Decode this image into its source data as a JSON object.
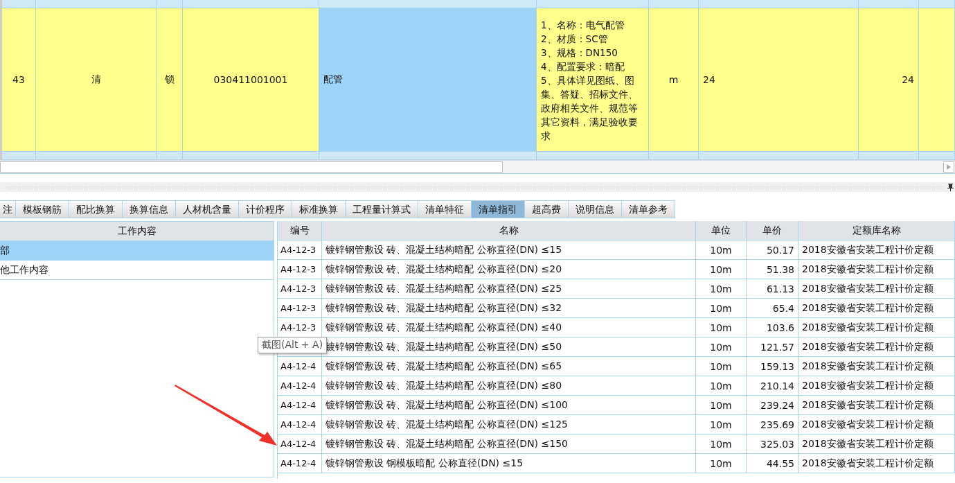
{
  "top_table": {
    "row": {
      "selected": true,
      "cells": [
        {
          "kind": "center",
          "text": "43"
        },
        {
          "kind": "center",
          "text": "清"
        },
        {
          "kind": "center",
          "text": "锁"
        },
        {
          "kind": "center",
          "text": "030411001001"
        },
        {
          "kind": "selected",
          "text": "配管"
        },
        {
          "kind": "multiline",
          "text": "1、名称：电气配管\n2、材质：SC管\n3、规格：DN150\n4、配置要求：暗配\n5、具体详见图纸、图集、答疑、招标文件、政府相关文件、规范等其它资料，满足验收要求"
        },
        {
          "kind": "center",
          "text": "m"
        },
        {
          "kind": "left",
          "text": "24"
        },
        {
          "kind": "right",
          "text": "24"
        },
        {
          "kind": "empty"
        }
      ]
    }
  },
  "tabs": [
    {
      "label": "注",
      "selected": false
    },
    {
      "label": "模板钢筋",
      "selected": false
    },
    {
      "label": "配比换算",
      "selected": false
    },
    {
      "label": "换算信息",
      "selected": false
    },
    {
      "label": "人材机含量",
      "selected": false
    },
    {
      "label": "计价程序",
      "selected": false
    },
    {
      "label": "标准换算",
      "selected": false
    },
    {
      "label": "工程量计算式",
      "selected": false
    },
    {
      "label": "清单特征",
      "selected": false
    },
    {
      "label": "清单指引",
      "selected": true
    },
    {
      "label": "超高费",
      "selected": false
    },
    {
      "label": "说明信息",
      "selected": false
    },
    {
      "label": "清单参考",
      "selected": false
    }
  ],
  "work_panel": {
    "header": "工作内容",
    "items": [
      {
        "text": "部",
        "selected": true
      },
      {
        "text": "他工作内容",
        "selected": false
      }
    ]
  },
  "quota_table": {
    "columns": [
      "编号",
      "名称",
      "单位",
      "单价",
      "定额库名称"
    ],
    "rows": [
      [
        "A4-12-3",
        "镀锌钢管敷设 砖、混凝土结构暗配 公称直径(DN) ≤15",
        "10m",
        "50.17",
        "2018安徽省安装工程计价定额"
      ],
      [
        "A4-12-3",
        "镀锌钢管敷设 砖、混凝土结构暗配 公称直径(DN) ≤20",
        "10m",
        "51.38",
        "2018安徽省安装工程计价定额"
      ],
      [
        "A4-12-3",
        "镀锌钢管敷设 砖、混凝土结构暗配 公称直径(DN) ≤25",
        "10m",
        "61.13",
        "2018安徽省安装工程计价定额"
      ],
      [
        "A4-12-3",
        "镀锌钢管敷设 砖、混凝土结构暗配 公称直径(DN) ≤32",
        "10m",
        "65.4",
        "2018安徽省安装工程计价定额"
      ],
      [
        "A4-12-3",
        "镀锌钢管敷设 砖、混凝土结构暗配 公称直径(DN) ≤40",
        "10m",
        "103.6",
        "2018安徽省安装工程计价定额"
      ],
      [
        null,
        "镀锌钢管敷设 砖、混凝土结构暗配 公称直径(DN) ≤50",
        "10m",
        "121.57",
        "2018安徽省安装工程计价定额"
      ],
      [
        "A4-12-4",
        "镀锌钢管敷设 砖、混凝土结构暗配 公称直径(DN) ≤65",
        "10m",
        "159.13",
        "2018安徽省安装工程计价定额"
      ],
      [
        "A4-12-4",
        "镀锌钢管敷设 砖、混凝土结构暗配 公称直径(DN) ≤80",
        "10m",
        "210.14",
        "2018安徽省安装工程计价定额"
      ],
      [
        "A4-12-4",
        "镀锌钢管敷设 砖、混凝土结构暗配 公称直径(DN) ≤100",
        "10m",
        "239.24",
        "2018安徽省安装工程计价定额"
      ],
      [
        "A4-12-4",
        "镀锌钢管敷设 砖、混凝土结构暗配 公称直径(DN) ≤125",
        "10m",
        "235.69",
        "2018安徽省安装工程计价定额"
      ],
      [
        "A4-12-4",
        "镀锌钢管敷设 砖、混凝土结构暗配 公称直径(DN) ≤150",
        "10m",
        "325.03",
        "2018安徽省安装工程计价定额"
      ],
      [
        "A4-12-4",
        "镀锌钢管敷设 钢模板暗配 公称直径(DN) ≤15",
        "10m",
        "44.55",
        "2018安徽省安装工程计价定额"
      ]
    ]
  },
  "tooltip": {
    "text": "截图(Alt + A)"
  }
}
